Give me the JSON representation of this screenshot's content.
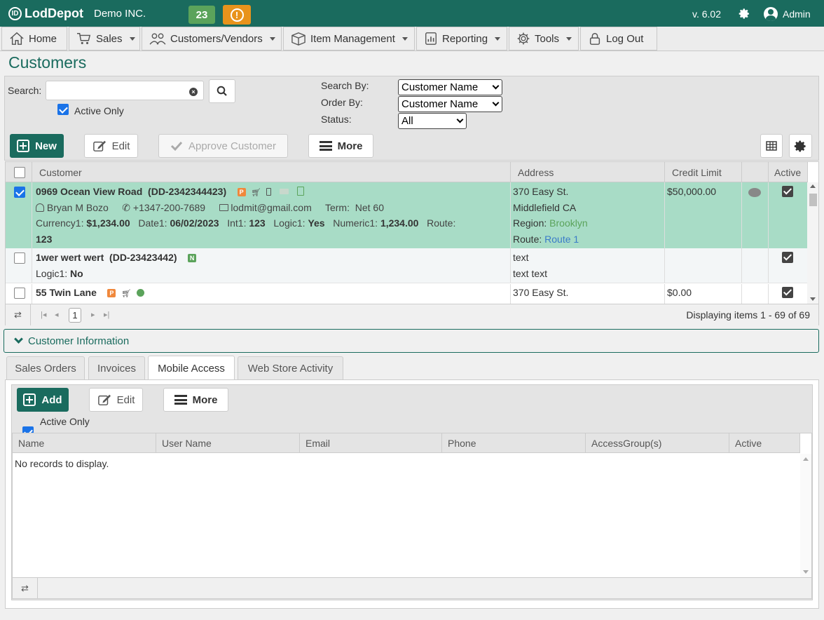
{
  "header": {
    "logo": "LodDepot",
    "company": "Demo INC.",
    "notification_count": "23",
    "warning_icon": "exclamation-icon",
    "version": "v. 6.02",
    "user": "Admin"
  },
  "nav": [
    {
      "label": "Home",
      "icon": "home-icon"
    },
    {
      "label": "Sales",
      "icon": "cart-icon"
    },
    {
      "label": "Customers/Vendors",
      "icon": "users-icon"
    },
    {
      "label": "Item Management",
      "icon": "box-icon"
    },
    {
      "label": "Reporting",
      "icon": "report-icon"
    },
    {
      "label": "Tools",
      "icon": "gear-icon"
    },
    {
      "label": "Log Out",
      "icon": "lock-icon"
    }
  ],
  "page_title": "Customers",
  "search": {
    "label": "Search:",
    "value": "",
    "active_only_label": "Active Only",
    "search_by_label": "Search By:",
    "search_by_value": "Customer Name",
    "order_by_label": "Order By:",
    "order_by_value": "Customer Name",
    "status_label": "Status:",
    "status_value": "All"
  },
  "toolbar": {
    "new": "New",
    "edit": "Edit",
    "approve": "Approve Customer",
    "more": "More"
  },
  "grid": {
    "columns": [
      "Customer",
      "Address",
      "Credit Limit",
      "Active"
    ],
    "rows": [
      {
        "name": "0969 Ocean View Road",
        "code": "(DD-2342344423)",
        "contact": "Bryan M Bozo",
        "phone": "+1347-200-7689",
        "email": "lodmit@gmail.com",
        "term_label": "Term:",
        "term": "Net 60",
        "currency1_label": "Currency1:",
        "currency1": "$1,234.00",
        "date1_label": "Date1:",
        "date1": "06/02/2023",
        "int1_label": "Int1:",
        "int1": "123",
        "logic1_label": "Logic1:",
        "logic1": "Yes",
        "numeric1_label": "Numeric1:",
        "numeric1": "1,234.00",
        "route_label": "Route:",
        "route_value": "123",
        "address1": "370 Easy St.",
        "address2": "Middlefield CA",
        "region_label": "Region:",
        "region": "Brooklyn",
        "addr_route_label": "Route:",
        "addr_route": "Route 1",
        "credit_limit": "$50,000.00"
      },
      {
        "name": "1wer wert wert",
        "code": "(DD-23423442)",
        "tag": "N",
        "logic1_label": "Logic1:",
        "logic1": "No",
        "address1": "text",
        "address2": "text text",
        "credit_limit": ""
      },
      {
        "name": "55 Twin Lane",
        "address1": "370 Easy St.",
        "credit_limit": "$0.00"
      }
    ],
    "tag_p": "P",
    "page": "1",
    "display": "Displaying items 1 - 69 of 69"
  },
  "customer_info": "Customer Information",
  "tabs": [
    "Sales Orders",
    "Invoices",
    "Mobile Access",
    "Web Store Activity"
  ],
  "sub_toolbar": {
    "add": "Add",
    "edit": "Edit",
    "more": "More",
    "active_only": "Active Only"
  },
  "sub_grid": {
    "columns": [
      "Name",
      "User Name",
      "Email",
      "Phone",
      "AccessGroup(s)",
      "Active"
    ],
    "empty": "No records to display."
  },
  "colors": {
    "brand": "#1a6b5e",
    "selected_row": "#a8dcc6",
    "count_badge": "#5ba35b",
    "warning_badge": "#e8931c",
    "tag_p": "#f0883c",
    "tag_n": "#5ba35b"
  }
}
